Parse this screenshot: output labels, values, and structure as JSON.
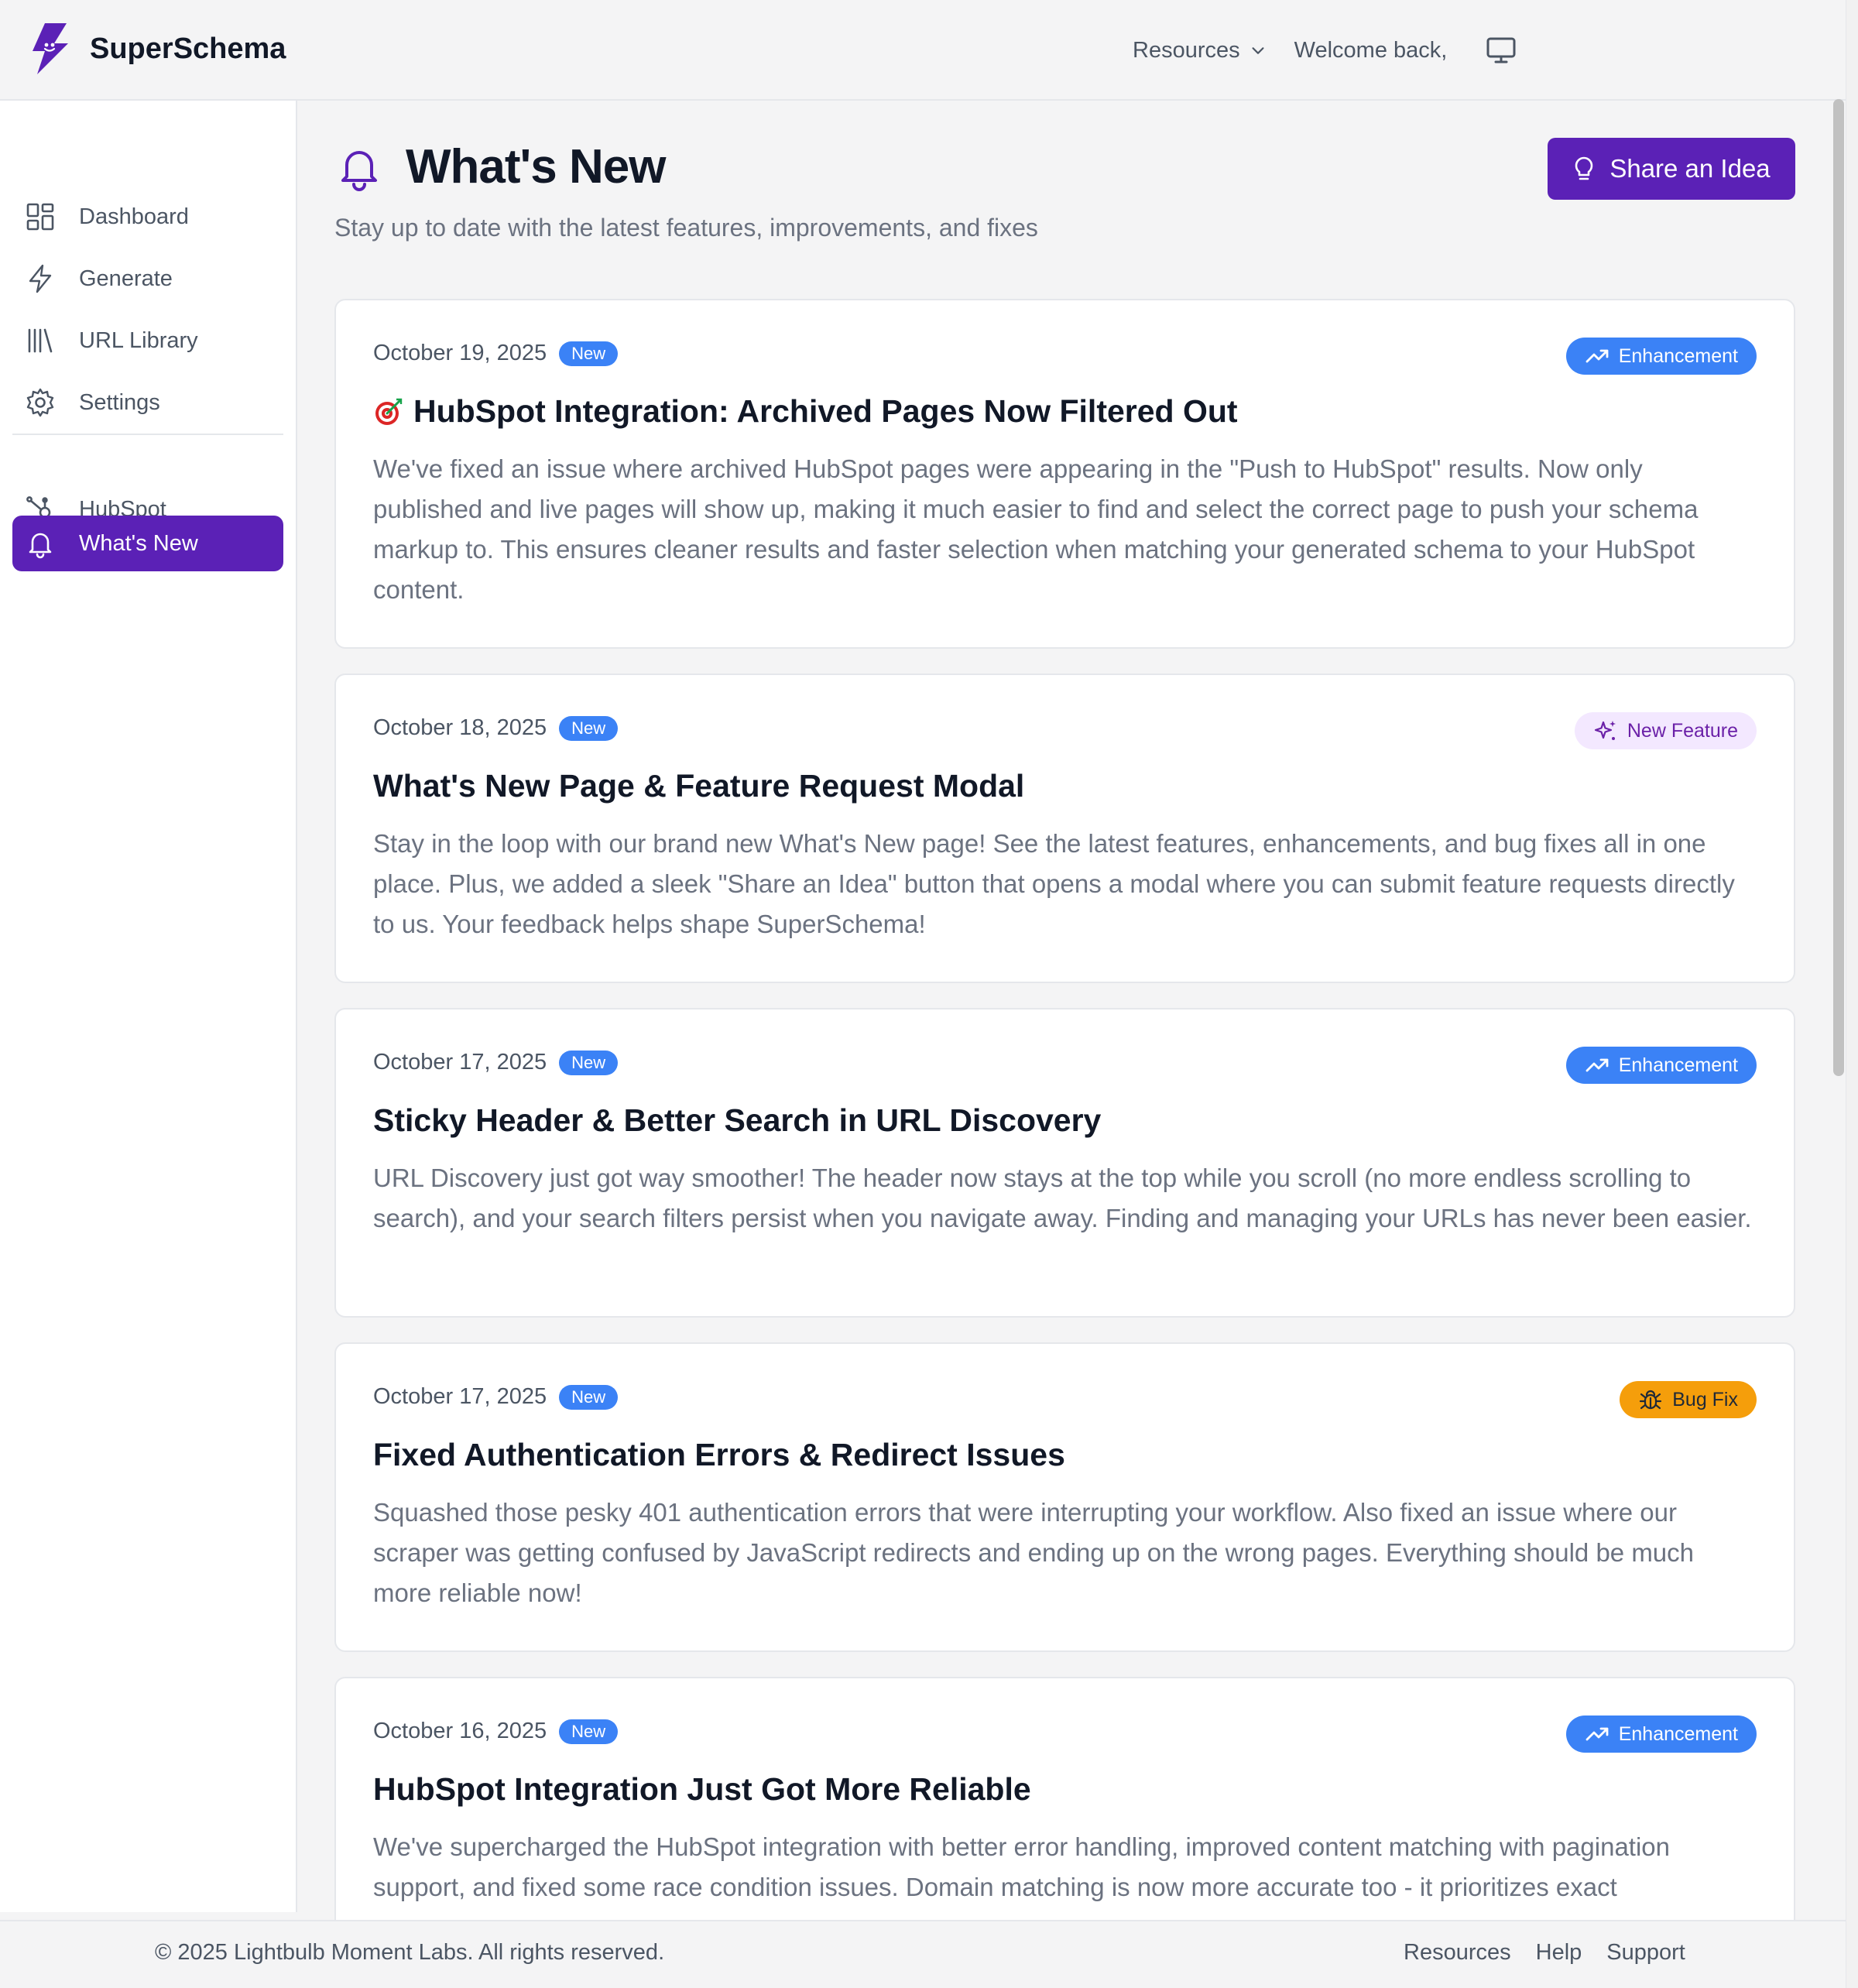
{
  "app": {
    "name": "SuperSchema",
    "logo_icon": "bolt-face-icon"
  },
  "header": {
    "resources_label": "Resources",
    "welcome_text": "Welcome back,",
    "monitor_icon": "monitor-icon"
  },
  "sidebar": {
    "items": [
      {
        "label": "Dashboard",
        "icon": "dashboard-icon"
      },
      {
        "label": "Generate",
        "icon": "bolt-icon"
      },
      {
        "label": "URL Library",
        "icon": "library-icon"
      },
      {
        "label": "Settings",
        "icon": "gear-icon"
      },
      {
        "label": "HubSpot",
        "icon": "hubspot-icon"
      },
      {
        "label": "What's New",
        "icon": "bell-icon",
        "active": true
      }
    ]
  },
  "page": {
    "title": "What's New",
    "subtitle": "Stay up to date with the latest features, improvements, and fixes",
    "share_button": "Share an Idea"
  },
  "updates": [
    {
      "date": "October 19, 2025",
      "new_label": "New",
      "badge": "Enhancement",
      "badge_type": "enhancement",
      "title": "HubSpot Integration: Archived Pages Now Filtered Out",
      "has_emoji": true,
      "emoji_icon": "target-icon",
      "body": "We've fixed an issue where archived HubSpot pages were appearing in the \"Push to HubSpot\" results. Now only published and live pages will show up, making it much easier to find and select the correct page to push your schema markup to. This ensures cleaner results and faster selection when matching your generated schema to your HubSpot content."
    },
    {
      "date": "October 18, 2025",
      "new_label": "New",
      "badge": "New Feature",
      "badge_type": "feature",
      "title": "What's New Page & Feature Request Modal",
      "body": "Stay in the loop with our brand new What's New page! See the latest features, enhancements, and bug fixes all in one place. Plus, we added a sleek \"Share an Idea\" button that opens a modal where you can submit feature requests directly to us. Your feedback helps shape SuperSchema!"
    },
    {
      "date": "October 17, 2025",
      "new_label": "New",
      "badge": "Enhancement",
      "badge_type": "enhancement",
      "title": "Sticky Header & Better Search in URL Discovery",
      "body": "URL Discovery just got way smoother! The header now stays at the top while you scroll (no more endless scrolling to search), and your search filters persist when you navigate away. Finding and managing your URLs has never been easier."
    },
    {
      "date": "October 17, 2025",
      "new_label": "New",
      "badge": "Bug Fix",
      "badge_type": "bugfix",
      "title": "Fixed Authentication Errors & Redirect Issues",
      "body": "Squashed those pesky 401 authentication errors that were interrupting your workflow. Also fixed an issue where our scraper was getting confused by JavaScript redirects and ending up on the wrong pages. Everything should be much more reliable now!"
    },
    {
      "date": "October 16, 2025",
      "new_label": "New",
      "badge": "Enhancement",
      "badge_type": "enhancement",
      "title": "HubSpot Integration Just Got More Reliable",
      "body": "We've supercharged the HubSpot integration with better error handling, improved content matching with pagination support, and fixed some race condition issues. Domain matching is now more accurate too - it prioritizes exact"
    }
  ],
  "footer": {
    "copyright": "© 2025 Lightbulb Moment Labs. All rights reserved.",
    "links": [
      "Resources",
      "Help",
      "Support"
    ]
  },
  "colors": {
    "primary": "#5b21b6",
    "enhancement": "#3b82f6",
    "feature_bg": "#f3e8ff",
    "bugfix": "#f59e0b"
  }
}
